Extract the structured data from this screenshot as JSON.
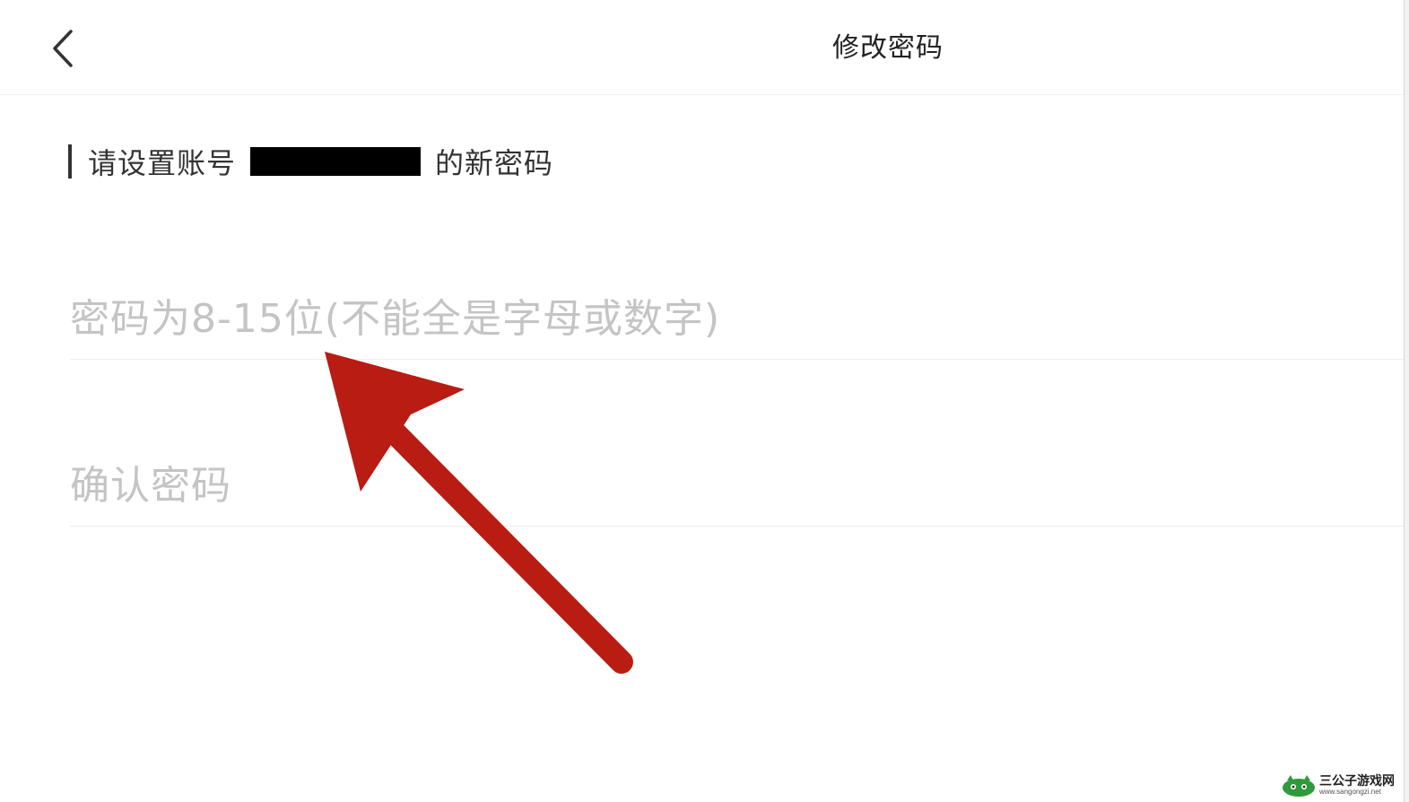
{
  "nav": {
    "back_icon": "chevron-left-icon",
    "title": "修改密码"
  },
  "prompt": {
    "prefix": "请设置账号",
    "suffix": "的新密码"
  },
  "fields": {
    "new_password": {
      "value": "",
      "placeholder": "密码为8-15位(不能全是字母或数字)"
    },
    "confirm_password": {
      "value": "",
      "placeholder": "确认密码"
    }
  },
  "annotation": {
    "color": "#b81c12"
  },
  "watermark": {
    "title": "三公子游戏网",
    "url": "www.sangongzi.net"
  }
}
